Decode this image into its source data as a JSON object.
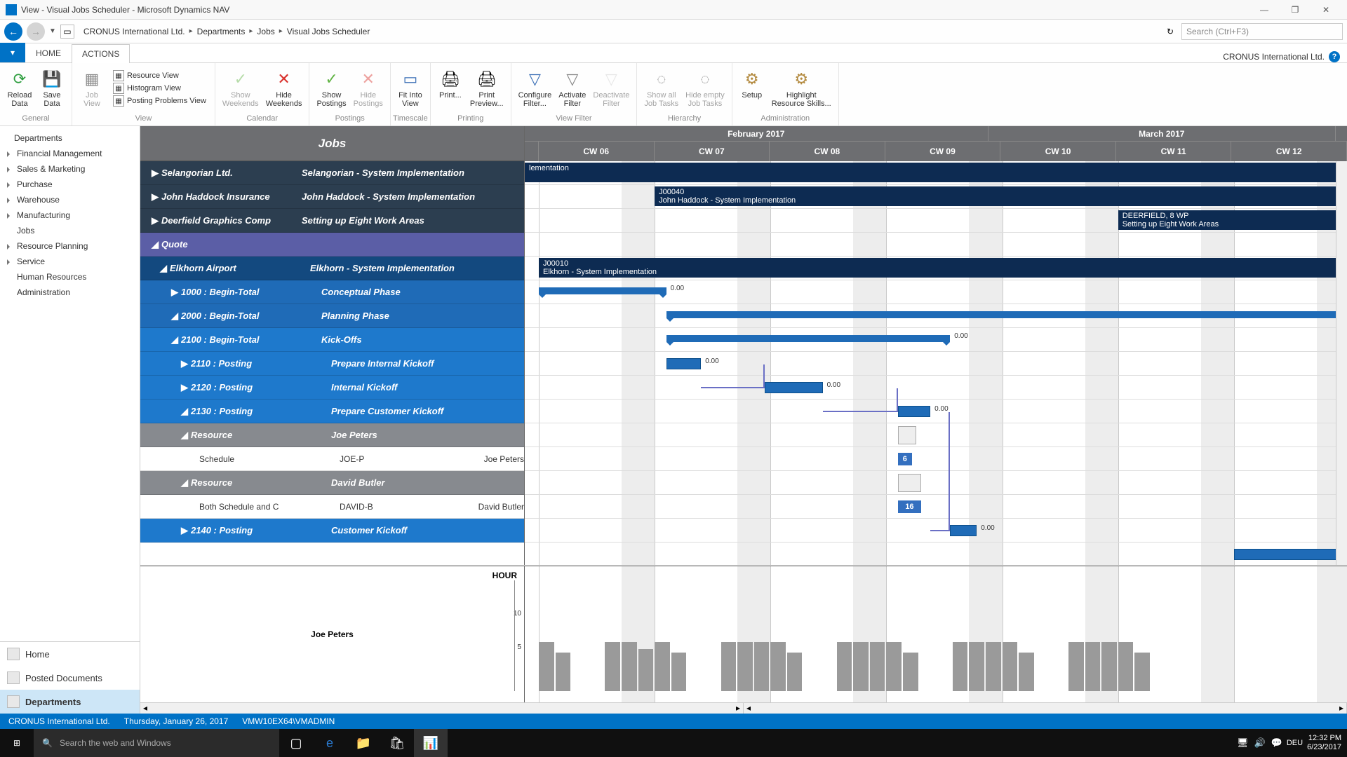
{
  "window": {
    "title": "View - Visual Jobs Scheduler - Microsoft Dynamics NAV"
  },
  "breadcrumbs": [
    "CRONUS International Ltd.",
    "Departments",
    "Jobs",
    "Visual Jobs Scheduler"
  ],
  "search_placeholder": "Search (Ctrl+F3)",
  "tabs": {
    "file": "▾",
    "home": "HOME",
    "actions": "ACTIONS"
  },
  "company": "CRONUS International Ltd.",
  "ribbon": {
    "groups": [
      {
        "label": "General",
        "type": "big",
        "items": [
          {
            "name": "reload-data",
            "label": "Reload\nData",
            "icon": "⟳",
            "color": "#2e9e3f",
            "dis": false
          },
          {
            "name": "save-data",
            "label": "Save\nData",
            "icon": "💾",
            "color": "#6b3fa0",
            "dis": false
          }
        ]
      },
      {
        "label": "View",
        "type": "mixed",
        "big": [
          {
            "name": "job-view",
            "label": "Job\nView",
            "icon": "▦",
            "dis": true
          }
        ],
        "list": [
          {
            "name": "resource-view",
            "label": "Resource View"
          },
          {
            "name": "histogram-view",
            "label": "Histogram View"
          },
          {
            "name": "posting-problems-view",
            "label": "Posting Problems View"
          }
        ]
      },
      {
        "label": "Calendar",
        "type": "big",
        "items": [
          {
            "name": "show-weekends",
            "label": "Show\nWeekends",
            "icon": "✓",
            "color": "#62b446",
            "dis": true
          },
          {
            "name": "hide-weekends",
            "label": "Hide\nWeekends",
            "icon": "✕",
            "color": "#d9332e",
            "dis": false
          }
        ]
      },
      {
        "label": "Postings",
        "type": "big",
        "items": [
          {
            "name": "show-postings",
            "label": "Show\nPostings",
            "icon": "✓",
            "color": "#62b446",
            "dis": false
          },
          {
            "name": "hide-postings",
            "label": "Hide\nPostings",
            "icon": "✕",
            "color": "#d9332e",
            "dis": true
          }
        ]
      },
      {
        "label": "Timescale",
        "type": "big",
        "items": [
          {
            "name": "fit-into-view",
            "label": "Fit Into\nView",
            "icon": "▭",
            "color": "#3b6fb6",
            "dis": false
          }
        ]
      },
      {
        "label": "Printing",
        "type": "big",
        "items": [
          {
            "name": "print",
            "label": "Print...",
            "icon": "🖨",
            "dis": false
          },
          {
            "name": "print-preview",
            "label": "Print\nPreview...",
            "icon": "🖨",
            "dis": false
          }
        ]
      },
      {
        "label": "View Filter",
        "type": "big",
        "items": [
          {
            "name": "configure-filter",
            "label": "Configure\nFilter...",
            "icon": "▽",
            "color": "#3b6fb6",
            "dis": false
          },
          {
            "name": "activate-filter",
            "label": "Activate\nFilter",
            "icon": "▽",
            "color": "#888",
            "dis": false
          },
          {
            "name": "deactivate-filter",
            "label": "Deactivate\nFilter",
            "icon": "▽",
            "color": "#ccc",
            "dis": true
          }
        ]
      },
      {
        "label": "Hierarchy",
        "type": "big",
        "items": [
          {
            "name": "show-all-job-tasks",
            "label": "Show all\nJob Tasks",
            "icon": "◌",
            "dis": true
          },
          {
            "name": "hide-empty-job-tasks",
            "label": "Hide empty\nJob Tasks",
            "icon": "◌",
            "dis": true
          }
        ]
      },
      {
        "label": "Administration",
        "type": "big",
        "items": [
          {
            "name": "setup",
            "label": "Setup",
            "icon": "⚙",
            "color": "#b38a3f",
            "dis": false
          },
          {
            "name": "highlight-resource-skills",
            "label": "Highlight\nResource Skills...",
            "icon": "⚙",
            "color": "#b38a3f",
            "dis": false
          }
        ]
      }
    ]
  },
  "nav": {
    "items": [
      "Departments",
      "Financial Management",
      "Sales & Marketing",
      "Purchase",
      "Warehouse",
      "Manufacturing",
      "Jobs",
      "Resource Planning",
      "Service",
      "Human Resources",
      "Administration"
    ],
    "bottom": [
      {
        "name": "home",
        "label": "Home",
        "active": false
      },
      {
        "name": "posted-documents",
        "label": "Posted Documents",
        "active": false
      },
      {
        "name": "departments",
        "label": "Departments",
        "active": true
      }
    ]
  },
  "jobsHeader": "Jobs",
  "timeline": {
    "months": [
      {
        "label": "February 2017",
        "weeks": 4
      },
      {
        "label": "March 2017",
        "weeks": 3
      }
    ],
    "weeks": [
      "CW 06",
      "CW 07",
      "CW 08",
      "CW 09",
      "CW 10",
      "CW 11",
      "CW 12"
    ]
  },
  "rows": [
    {
      "cls": "dark",
      "chev": "▶",
      "c1": "Selangorian Ltd.",
      "c2": "Selangorian - System Implementation"
    },
    {
      "cls": "dark",
      "chev": "▶",
      "c1": "John Haddock Insurance",
      "c2": "John Haddock - System Implementation"
    },
    {
      "cls": "dark",
      "chev": "▶",
      "c1": "Deerfield Graphics Comp",
      "c2": "Setting up Eight Work Areas"
    },
    {
      "cls": "purple",
      "chev": "◢",
      "c1": "Quote",
      "c2": ""
    },
    {
      "cls": "blue1",
      "chev": "◢",
      "c1": "Elkhorn Airport",
      "c2": "Elkhorn - System Implementation",
      "indent": "indent1"
    },
    {
      "cls": "blue2",
      "chev": "▶",
      "c1": "1000 : Begin-Total",
      "c2": "Conceptual Phase",
      "indent": "indent2"
    },
    {
      "cls": "blue2",
      "chev": "◢",
      "c1": "2000 : Begin-Total",
      "c2": "Planning Phase",
      "indent": "indent2"
    },
    {
      "cls": "blue3",
      "chev": "◢",
      "c1": "2100 : Begin-Total",
      "c2": "Kick-Offs",
      "indent": "indent2"
    },
    {
      "cls": "blue3",
      "chev": "▶",
      "c1": "2110 : Posting",
      "c2": "Prepare Internal Kickoff",
      "indent": "indent3"
    },
    {
      "cls": "blue3",
      "chev": "▶",
      "c1": "2120 : Posting",
      "c2": "Internal Kickoff",
      "indent": "indent3"
    },
    {
      "cls": "blue3",
      "chev": "◢",
      "c1": "2130 : Posting",
      "c2": "Prepare Customer Kickoff",
      "indent": "indent3"
    },
    {
      "cls": "gray",
      "chev": "◢",
      "c1": "Resource",
      "c2": "Joe Peters",
      "indent": "indent3"
    },
    {
      "cls": "white",
      "chev": "",
      "c1": "Schedule",
      "c2": "JOE-P",
      "c3": "Joe Peters",
      "indent": "indent4"
    },
    {
      "cls": "gray",
      "chev": "◢",
      "c1": "Resource",
      "c2": "David Butler",
      "indent": "indent3"
    },
    {
      "cls": "white",
      "chev": "",
      "c1": "Both Schedule and C",
      "c2": "DAVID-B",
      "c3": "David Butler",
      "indent": "indent4"
    },
    {
      "cls": "blue3",
      "chev": "▶",
      "c1": "2140 : Posting",
      "c2": "Customer Kickoff",
      "indent": "indent3"
    }
  ],
  "bars": {
    "selangorian": {
      "label": "lementation"
    },
    "haddock": {
      "code": "J00040",
      "label": "John Haddock - System Implementation"
    },
    "deerfield": {
      "code": "DEERFIELD, 8 WP",
      "label": "Setting up Eight Work Areas"
    },
    "elkhorn": {
      "code": "J00010",
      "label": "Elkhorn - System Implementation"
    },
    "vals": {
      "v1": "0.00",
      "v2": "0.00",
      "v3": "0.00",
      "v4": "0.00",
      "v5": "0.00",
      "v6": "0.00"
    },
    "alloc": {
      "joe": "6",
      "david": "16"
    }
  },
  "capacity": {
    "unit": "HOUR",
    "resource": "Joe Peters",
    "ticks": [
      "10",
      "5"
    ]
  },
  "status": {
    "company": "CRONUS International Ltd.",
    "date": "Thursday, January 26, 2017",
    "machine": "VMW10EX64\\VMADMIN"
  },
  "taskbar": {
    "search": "Search the web and Windows",
    "lang": "DEU",
    "time": "12:32 PM",
    "date": "6/23/2017"
  },
  "chart_data": {
    "type": "bar",
    "title": "Capacity — Joe Peters",
    "ylabel": "HOUR",
    "ylim": [
      0,
      10
    ],
    "x": "workdays CW06–CW12 (weekends grayed)",
    "series": [
      {
        "name": "Joe Peters",
        "values_approx": "bars ≈ 5–8 hours per working day across the visible range"
      }
    ]
  }
}
